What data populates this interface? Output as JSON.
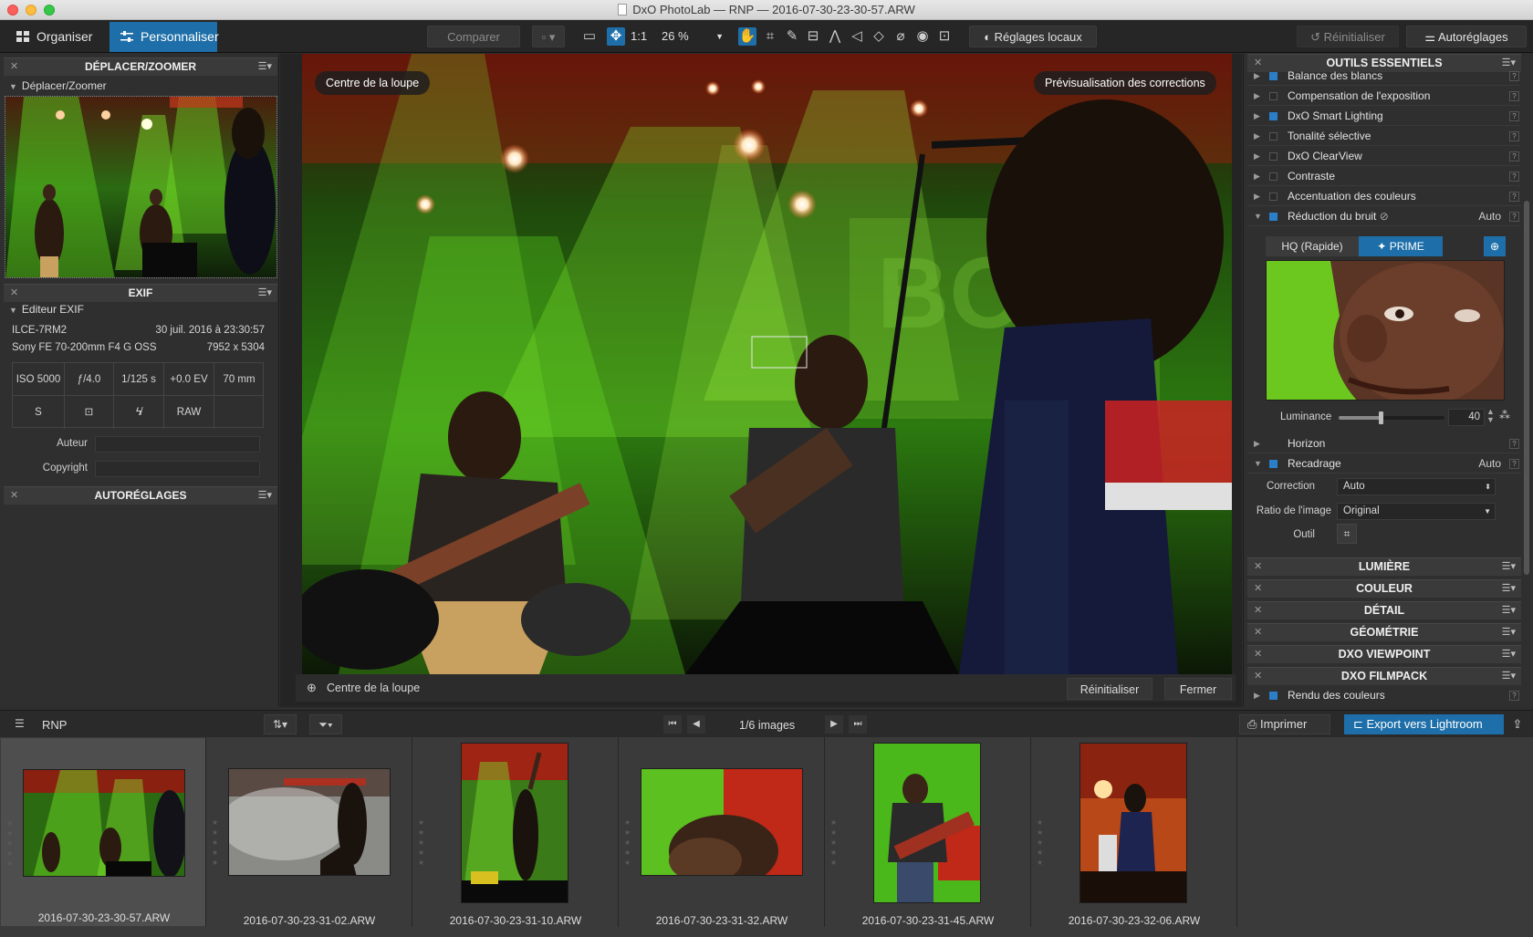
{
  "titlebar": {
    "title": "DxO PhotoLab — RNP — 2016-07-30-23-30-57.ARW"
  },
  "toolbar": {
    "tab_organize": "Organiser",
    "tab_customize": "Personnaliser",
    "compare": "Comparer",
    "one_to_one": "1:1",
    "zoom": "26 %",
    "local_adjust": "Réglages locaux",
    "reset": "Réinitialiser",
    "auto": "Autoréglages"
  },
  "left": {
    "move_zoom_header": "DÉPLACER/ZOOMER",
    "move_zoom_sub": "Déplacer/Zoomer",
    "exif_header": "EXIF",
    "exif_sub": "Editeur EXIF",
    "camera": "ILCE-7RM2",
    "date": "30 juil. 2016 à 23:30:57",
    "lens": "Sony FE 70-200mm F4 G OSS",
    "dims": "7952 x 5304",
    "iso": "ISO 5000",
    "aperture": "ƒ/4.0",
    "shutter": "1/125 s",
    "ev": "+0.0 EV",
    "focal": "70 mm",
    "mode": "S",
    "raw": "RAW",
    "author_label": "Auteur",
    "copyright_label": "Copyright",
    "autoreg_header": "AUTORÉGLAGES"
  },
  "viewer": {
    "loupe_center": "Centre de la loupe",
    "preview": "Prévisualisation des corrections",
    "bottom_label": "Centre de la loupe",
    "reset": "Réinitialiser",
    "close": "Fermer"
  },
  "right": {
    "essentials_header": "OUTILS ESSENTIELS",
    "tools": [
      {
        "label": "Balance des blancs",
        "checked": true
      },
      {
        "label": "Compensation de l'exposition",
        "checked": false
      },
      {
        "label": "DxO Smart Lighting",
        "checked": true
      },
      {
        "label": "Tonalité sélective",
        "checked": false
      },
      {
        "label": "DxO ClearView",
        "checked": false
      },
      {
        "label": "Contraste",
        "checked": false
      },
      {
        "label": "Accentuation des couleurs",
        "checked": false
      },
      {
        "label": "Réduction du bruit",
        "checked": true
      }
    ],
    "noise_auto": "Auto",
    "hq": "HQ (Rapide)",
    "prime": "PRIME",
    "luminance_label": "Luminance",
    "luminance_value": "40",
    "luminance_level": 0.4,
    "horizon": "Horizon",
    "recadrage": "Recadrage",
    "recadrage_auto": "Auto",
    "correction_label": "Correction",
    "correction_value": "Auto",
    "ratio_label": "Ratio de l'image",
    "ratio_value": "Original",
    "outil_label": "Outil",
    "sections": [
      "LUMIÈRE",
      "COULEUR",
      "DÉTAIL",
      "GÉOMÉTRIE",
      "DXO VIEWPOINT",
      "DXO FILMPACK"
    ],
    "rendu": "Rendu des couleurs"
  },
  "filmbar": {
    "project": "RNP",
    "counter": "1/6 images",
    "print": "Imprimer",
    "export": "Export vers Lightroom"
  },
  "film": [
    {
      "name": "2016-07-30-23-30-57.ARW"
    },
    {
      "name": "2016-07-30-23-31-02.ARW"
    },
    {
      "name": "2016-07-30-23-31-10.ARW"
    },
    {
      "name": "2016-07-30-23-31-32.ARW"
    },
    {
      "name": "2016-07-30-23-31-45.ARW"
    },
    {
      "name": "2016-07-30-23-32-06.ARW"
    }
  ],
  "colors": {
    "accent": "#1e6fa9",
    "stage_green": "#3fae1c",
    "stage_red": "#b8221a"
  }
}
